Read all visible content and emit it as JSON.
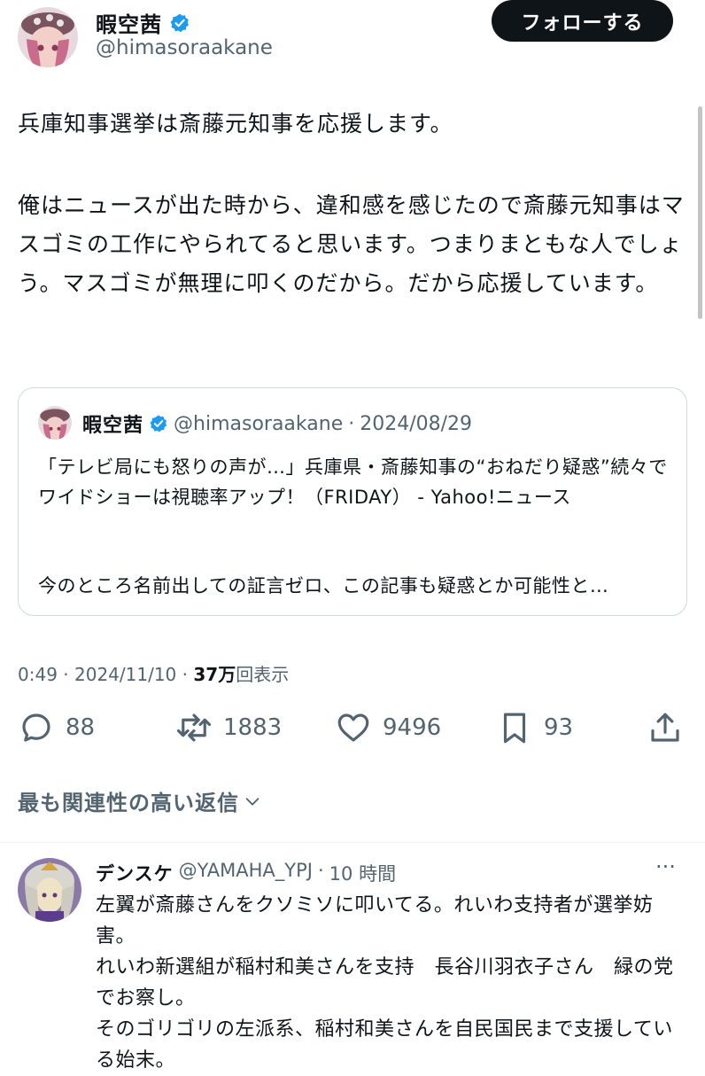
{
  "tweet": {
    "display_name": "暇空茜",
    "handle": "@himasoraakane",
    "follow_label": "フォローする",
    "text_1": "兵庫知事選挙は斎藤元知事を応援します。",
    "text_2": "俺はニュースが出た時から、違和感を感じたので斎藤元知事はマスゴミの工作にやられてると思います。つまりまともな人でしょう。マスゴミが無理に叩くのだから。だから応援しています。",
    "time": "0:49",
    "date": "2024/11/10",
    "views_count": "37万",
    "views_label": "回表示",
    "sep": "·"
  },
  "quote": {
    "display_name": "暇空茜",
    "handle": "@himasoraakane",
    "date": "2024/08/29",
    "sep": "·",
    "text_1": "「テレビ局にも怒りの声が…」兵庫県・斎藤知事の“おねだり疑惑”続々でワイドショーは視聴率アップ！（FRIDAY） - Yahoo!ニュース",
    "text_2": "今のところ名前出しての証言ゼロ、この記事も疑惑とか可能性と…"
  },
  "actions": {
    "replies": "88",
    "retweets": "1883",
    "likes": "9496",
    "bookmarks": "93"
  },
  "relevant_label": "最も関連性の高い返信",
  "reply": {
    "display_name": "デンスケ",
    "handle": "@YAMAHA_YPJ",
    "sep": "·",
    "time": "10 時間",
    "more": "···",
    "lines": [
      "左翼が斎藤さんをクソミソに叩いてる。れいわ支持者が選挙妨害。",
      "れいわ新選組が稲村和美さんを支持　長谷川羽衣子さん　緑の党でお察し。",
      "そのゴリゴリの左派系、稲村和美さんを自民国民まで支援している始末。"
    ]
  },
  "colors": {
    "text": "#0f1419",
    "muted": "#536471",
    "verified": "#1d9bf0",
    "border": "#cfd9de"
  }
}
